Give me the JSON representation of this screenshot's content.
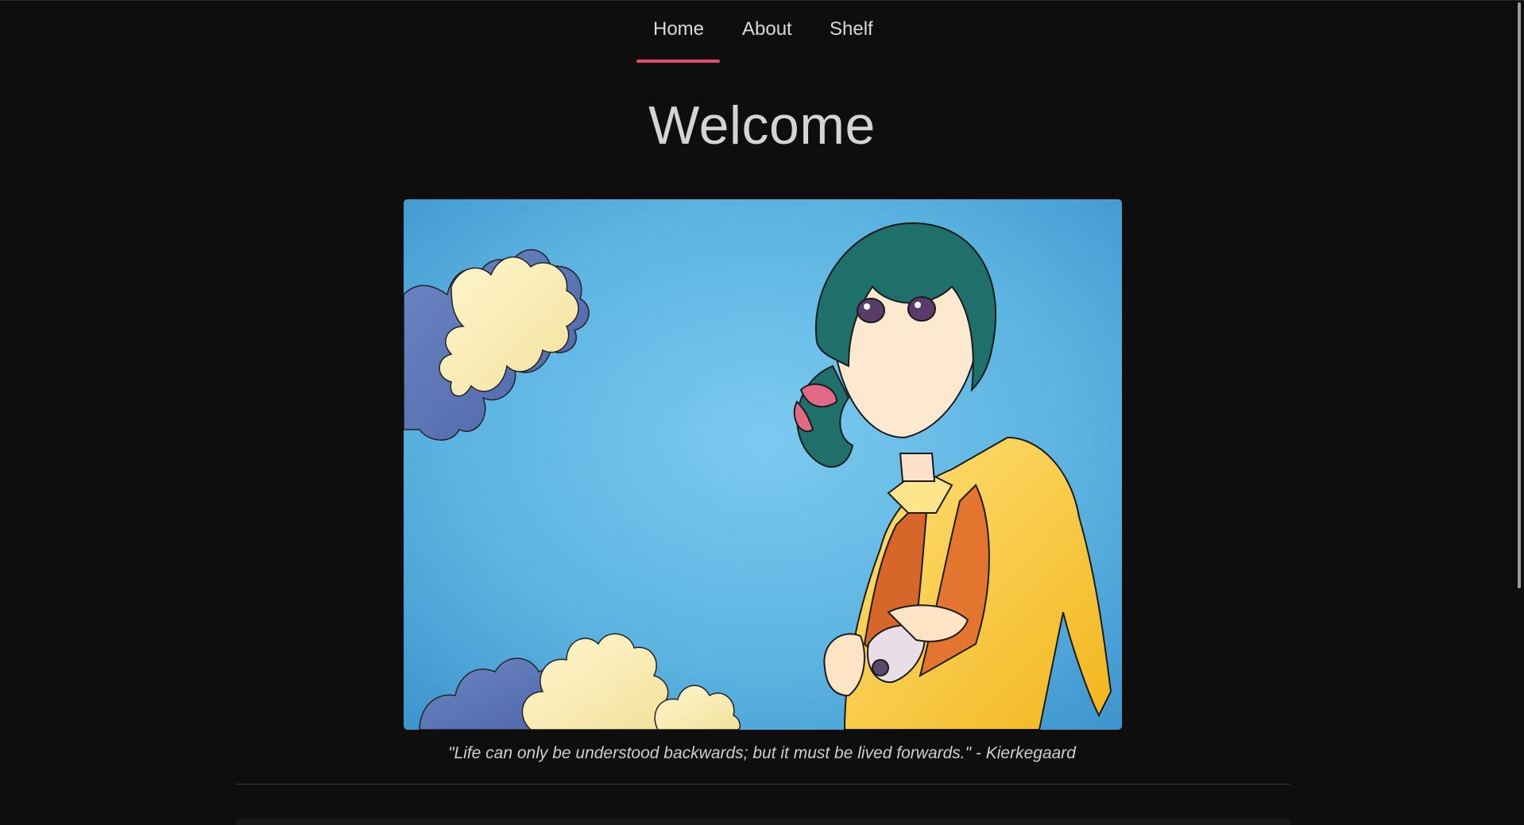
{
  "nav": {
    "items": [
      {
        "label": "Home",
        "active": true
      },
      {
        "label": "About",
        "active": false
      },
      {
        "label": "Shelf",
        "active": false
      }
    ],
    "accent_color": "#e8476e"
  },
  "main": {
    "title": "Welcome",
    "hero_image": {
      "sky_color": "#5fb6e2"
    },
    "quote": "\"Life can only be understood backwards; but it must be lived forwards.\" - Kierkegaard"
  },
  "colors": {
    "background": "#0e0e0e",
    "text": "#d6d6d6"
  }
}
